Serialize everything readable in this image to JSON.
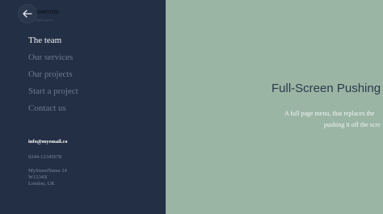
{
  "logo": {
    "text": "IGNITION",
    "tagline": "digital agency"
  },
  "nav": {
    "items": [
      {
        "label": "The team",
        "active": true
      },
      {
        "label": "Our services",
        "active": false
      },
      {
        "label": "Our projects",
        "active": false
      },
      {
        "label": "Start a project",
        "active": false
      },
      {
        "label": "Contact us",
        "active": false
      }
    ]
  },
  "contact": {
    "email": "info@myemail.co",
    "phone": "0244-12345678",
    "address": [
      "MyStreetName 24",
      "W1234X",
      "London, UK"
    ]
  },
  "main": {
    "title": "Full-Screen Pushing",
    "description_line1": "A full page menu, that replaces the",
    "description_line2": "pushing it off the scre"
  },
  "colors": {
    "menu_background": "#232f45",
    "page_background": "#9ab5a4",
    "nav_active": "#f2f4f7",
    "nav_inactive": "#6d7a90",
    "title": "#2b3a4c"
  },
  "icons": {
    "back": "arrow-left-icon"
  }
}
